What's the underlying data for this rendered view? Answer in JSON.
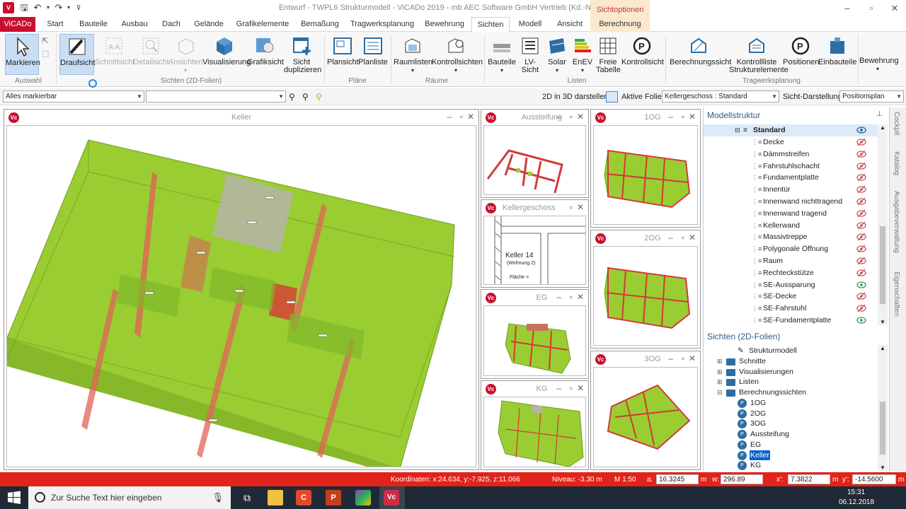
{
  "window": {
    "title": "Entwurf - TWPL6 Strukturmodell - ViCADo 2019 - mb AEC Software GmbH Vertrieb (Kd.-Nr. 60000)",
    "context_header": "Sichtoptionen",
    "controls": [
      "–",
      "▫",
      "✕"
    ]
  },
  "tabs": [
    {
      "label": "ViCADo"
    },
    {
      "label": "Start"
    },
    {
      "label": "Bauteile"
    },
    {
      "label": "Ausbau"
    },
    {
      "label": "Dach"
    },
    {
      "label": "Gelände"
    },
    {
      "label": "Grafikelemente"
    },
    {
      "label": "Bemaßung"
    },
    {
      "label": "Tragwerksplanung"
    },
    {
      "label": "Bewehrung"
    },
    {
      "label": "Sichten"
    },
    {
      "label": "Modell"
    },
    {
      "label": "Ansicht"
    },
    {
      "label": "Berechnung"
    }
  ],
  "ribbon": {
    "buttons": [
      {
        "label": "Markieren"
      },
      {
        "label": "Draufsicht"
      },
      {
        "label": "Schnittsicht"
      },
      {
        "label": "Detailsicht"
      },
      {
        "label": "Ansichten"
      },
      {
        "label": "Visualisierung"
      },
      {
        "label": "Grafiksicht"
      },
      {
        "label": "Sicht duplizieren"
      },
      {
        "label": "Plansicht"
      },
      {
        "label": "Planliste"
      },
      {
        "label": "Raumlisten"
      },
      {
        "label": "Kontrollsichten"
      },
      {
        "label": "Bauteile"
      },
      {
        "label": "LV-Sicht"
      },
      {
        "label": "Solar"
      },
      {
        "label": "EnEV"
      },
      {
        "label": "Freie Tabelle"
      },
      {
        "label": "Kontrollsicht"
      },
      {
        "label": "Berechnungssicht"
      },
      {
        "label": "Kontrollliste Strukturelemente"
      },
      {
        "label": "Positionen"
      },
      {
        "label": "Einbauteile"
      },
      {
        "label": "Bewehrung"
      }
    ],
    "groups": [
      "Auswahl",
      "Sichten (2D-Folien)",
      "Pläne",
      "Räume",
      "Listen",
      "Tragwerksplanung"
    ]
  },
  "optbar": {
    "select_filter": "Alles markierbar",
    "select_second": "",
    "label_2d3d": "2D in 3D darstellen:",
    "label_folie": "Aktive Folie:",
    "folie_value": "Kellergeschoss : Standard",
    "label_sicht": "Sicht-Darstellung:",
    "sicht_value": "Positionsplan"
  },
  "panes": {
    "main": "Keller",
    "aussteifung": "Aussteifung",
    "kellergeschoss": "Kellergeschoss",
    "eg": "EG",
    "kg": "KG",
    "og1": "1OG",
    "og2": "2OG",
    "og3": "3OG",
    "room": {
      "name": "Keller 14",
      "sub": "(Wohnung 2)",
      "area": "Fläche ="
    }
  },
  "modellstruktur": {
    "title": "Modellstruktur",
    "root": "Standard",
    "items": [
      {
        "label": "Decke",
        "visible": false
      },
      {
        "label": "Dämmstreifen",
        "visible": false
      },
      {
        "label": "Fahrstuhlschacht",
        "visible": false
      },
      {
        "label": "Fundamentplatte",
        "visible": false
      },
      {
        "label": "Innentür",
        "visible": false
      },
      {
        "label": "Innenwand nichttragend",
        "visible": false
      },
      {
        "label": "Innenwand tragend",
        "visible": false
      },
      {
        "label": "Kellerwand",
        "visible": false
      },
      {
        "label": "Massivtreppe",
        "visible": false
      },
      {
        "label": "Polygonale Öffnung",
        "visible": false
      },
      {
        "label": "Raum",
        "visible": false
      },
      {
        "label": "Rechteckstütze",
        "visible": false
      },
      {
        "label": "SE-Aussparung",
        "visible": true
      },
      {
        "label": "SE-Decke",
        "visible": false
      },
      {
        "label": "SE-Fahrstuhl",
        "visible": false
      },
      {
        "label": "SE-Fundamentplatte",
        "visible": true
      }
    ]
  },
  "sichten": {
    "title": "Sichten (2D-Folien)",
    "top": "Strukturmodell",
    "folders": [
      "Schnitte",
      "Visualisierungen",
      "Listen",
      "Berechnungssichten"
    ],
    "berechnung": [
      "1OG",
      "2OG",
      "3OG",
      "Aussteifung",
      "EG",
      "Keller",
      "KG"
    ],
    "selected": "Keller"
  },
  "sidetabs": [
    "Cockpit",
    "Katalog",
    "Ausgabeverwaltung",
    "Eigenschaften"
  ],
  "status": {
    "coords": "Koordinaten: x:24.634, y:-7.925, z:11.066",
    "niveau": "Niveau: -3.30 m",
    "scale": "M 1:50",
    "label_a": "a:",
    "val_a": "16.3245",
    "unit_a": "m",
    "label_w": "w:",
    "val_w": "296.89",
    "label_x": "x':",
    "val_x": "7.3822",
    "unit_x": "m",
    "label_y": "y':",
    "val_y": "-14.5600",
    "unit_y": "m"
  },
  "taskbar": {
    "search": "Zur Suche Text hier eingeben",
    "time": "15:31",
    "date": "06.12.2018"
  },
  "colors": {
    "accent": "#c8102e",
    "slab": "#9acd32",
    "wall": "#e0645a"
  }
}
